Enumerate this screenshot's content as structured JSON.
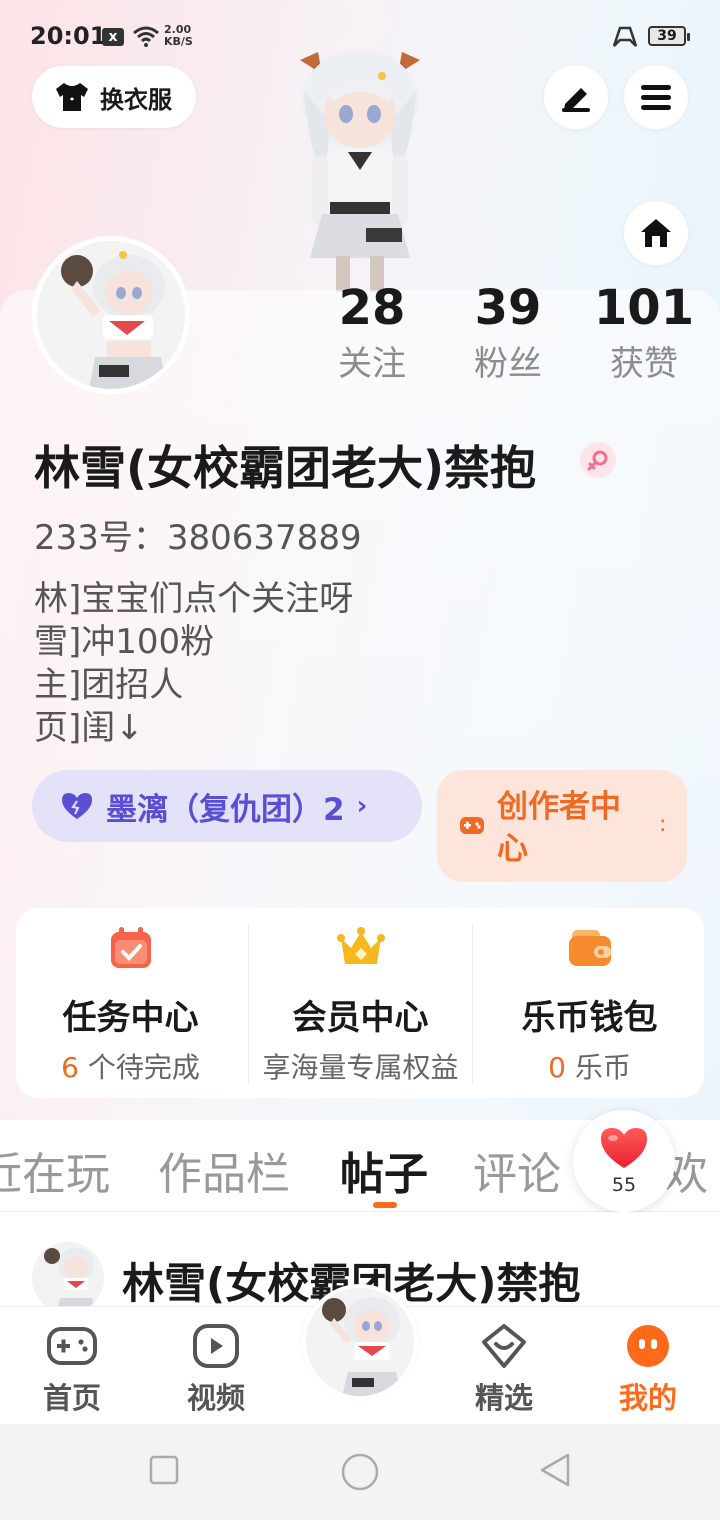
{
  "status_bar": {
    "time": "20:01",
    "notification_glyph": "x",
    "net_speed_value": "2.00",
    "net_speed_unit": "KB/S",
    "battery": "39",
    "icons": [
      "close-notification-icon",
      "wifi-icon",
      "game-mode-icon",
      "battery-icon"
    ]
  },
  "header": {
    "outfit_label": "换衣服",
    "icons": [
      "shirt-icon",
      "edit-icon",
      "menu-icon",
      "home-icon"
    ]
  },
  "profile": {
    "nickname": "林雪(女校霸团老大)禁抱",
    "gender": "female",
    "uid": "233号：380637889",
    "bio": [
      "林]宝宝们点个关注呀",
      "雪]冲100粉",
      "主]团招人",
      "页]闺↓"
    ]
  },
  "stats": {
    "following": {
      "value": "28",
      "label": "关注"
    },
    "followers": {
      "value": "39",
      "label": "粉丝"
    },
    "likes": {
      "value": "101",
      "label": "获赞"
    }
  },
  "guild": {
    "label": "墨漓（复仇团）2",
    "chevron": "›"
  },
  "creator": {
    "label": "创作者中心",
    "trailing": ":"
  },
  "services": [
    {
      "title": "任务中心",
      "highlight": "6",
      "sub": " 个待完成",
      "icon": "calendar-check-icon"
    },
    {
      "title": "会员中心",
      "highlight": "",
      "sub": "享海量专属权益",
      "icon": "crown-icon"
    },
    {
      "title": "乐币钱包",
      "highlight": "0",
      "sub": " 乐币",
      "icon": "wallet-icon"
    }
  ],
  "tabs": [
    "近在玩",
    "作品栏",
    "帖子",
    "评论",
    "欢"
  ],
  "active_tab": "帖子",
  "like_fab": {
    "count": "55"
  },
  "post_preview": {
    "author": "林雪(女校霸团老大)禁抱"
  },
  "bottom_nav": [
    {
      "label": "首页",
      "icon": "gamepad-icon"
    },
    {
      "label": "视频",
      "icon": "video-play-icon"
    },
    {
      "label": "精选",
      "icon": "heart-chat-icon"
    },
    {
      "label": "我的",
      "icon": "smile-face-icon"
    }
  ],
  "active_nav": "我的",
  "colors": {
    "accent": "#ff6a1a",
    "guild_text": "#5a4fd4",
    "guild_bg": "#e3e2f9",
    "creator_bg": "#fde5db",
    "gender": "#f07090"
  }
}
